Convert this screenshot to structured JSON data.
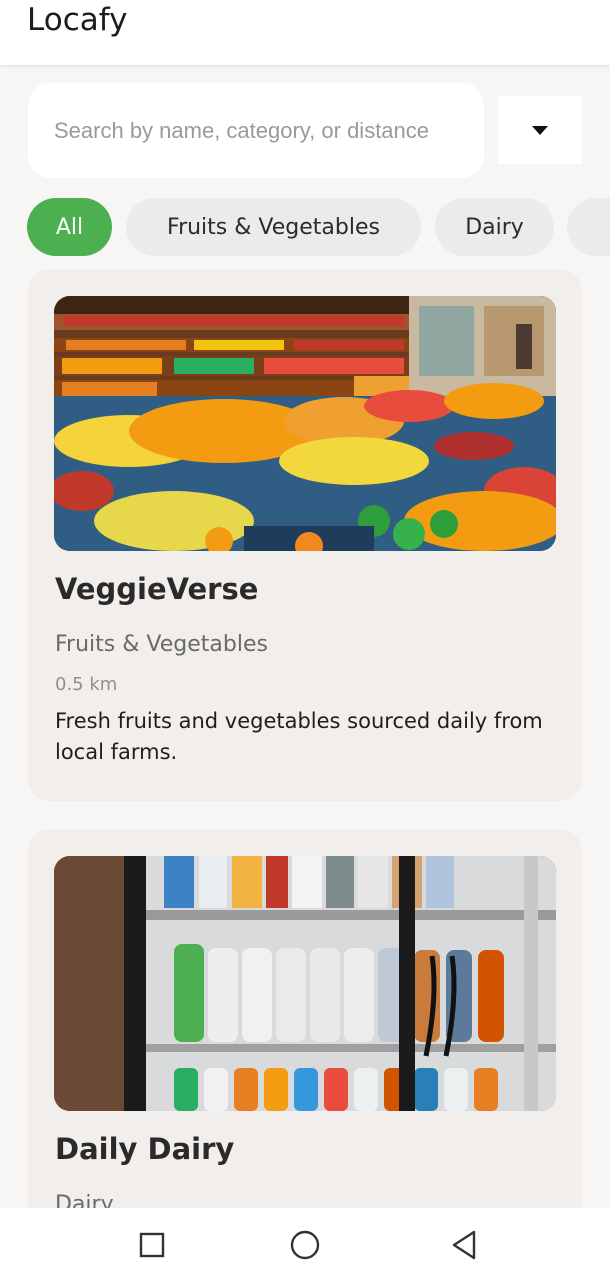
{
  "app": {
    "title": "Locafy"
  },
  "search": {
    "placeholder": "Search by name, category, or distance"
  },
  "filters": [
    {
      "label": "All",
      "active": true
    },
    {
      "label": "Fruits & Vegetables",
      "active": false
    },
    {
      "label": "Dairy",
      "active": false
    },
    {
      "label": "",
      "active": false
    }
  ],
  "stores": [
    {
      "name": "VeggieVerse",
      "category": "Fruits & Vegetables",
      "distance": "0.5 km",
      "description": "Fresh fruits and vegetables sourced daily from local farms."
    },
    {
      "name": "Daily Dairy",
      "category": "Dairy"
    }
  ],
  "colors": {
    "accent": "#4caf50",
    "chip": "#ecebe9",
    "card": "#f1eeeb",
    "background": "#f8f6f4"
  },
  "icons": {
    "dropdown": "chevron-down-icon",
    "nav_recents": "square-icon",
    "nav_home": "circle-icon",
    "nav_back": "triangle-back-icon"
  }
}
